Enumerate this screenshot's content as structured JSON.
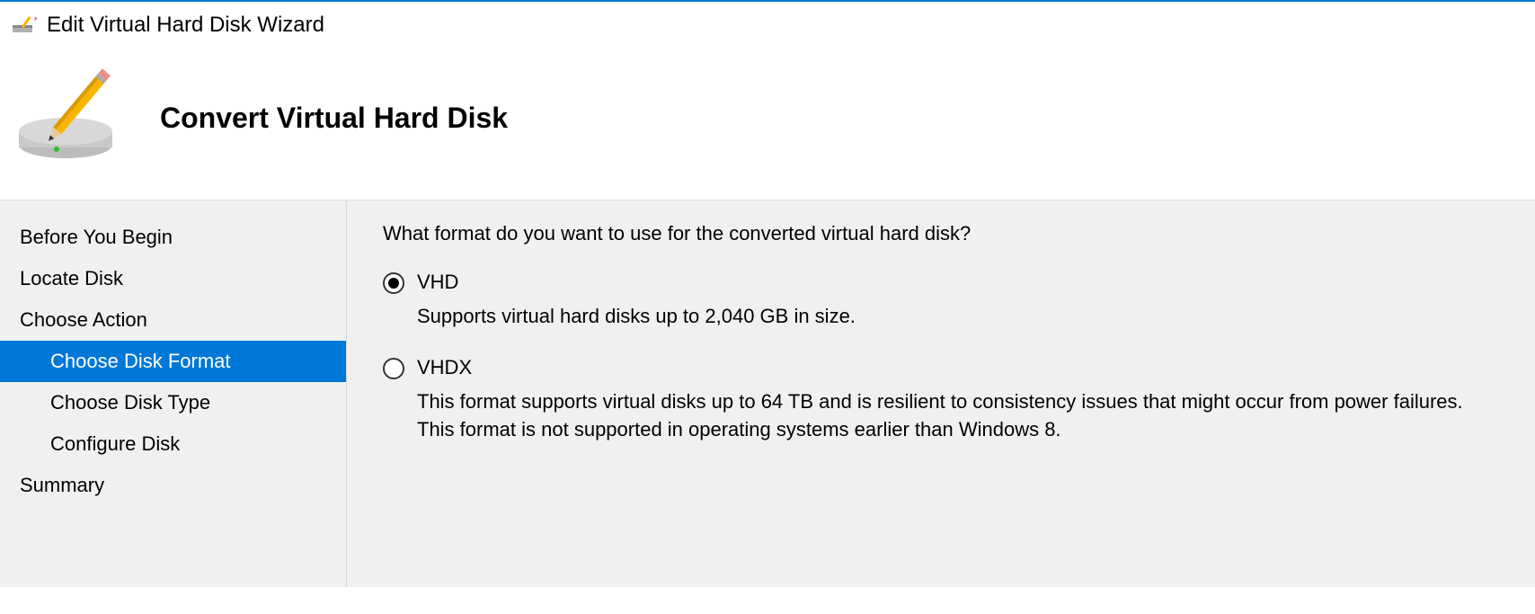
{
  "window": {
    "title": "Edit Virtual Hard Disk Wizard"
  },
  "header": {
    "title": "Convert Virtual Hard Disk"
  },
  "sidebar": {
    "items": [
      {
        "label": "Before You Begin",
        "sub": false,
        "selected": false
      },
      {
        "label": "Locate Disk",
        "sub": false,
        "selected": false
      },
      {
        "label": "Choose Action",
        "sub": false,
        "selected": false
      },
      {
        "label": "Choose Disk Format",
        "sub": true,
        "selected": true
      },
      {
        "label": "Choose Disk Type",
        "sub": true,
        "selected": false
      },
      {
        "label": "Configure Disk",
        "sub": true,
        "selected": false
      },
      {
        "label": "Summary",
        "sub": false,
        "selected": false
      }
    ]
  },
  "content": {
    "prompt": "What format do you want to use for the converted virtual hard disk?",
    "options": [
      {
        "label": "VHD",
        "checked": true,
        "description": "Supports virtual hard disks up to 2,040 GB in size."
      },
      {
        "label": "VHDX",
        "checked": false,
        "description": "This format supports virtual disks up to 64 TB and is resilient to consistency issues that might occur from power failures. This format is not supported in operating systems earlier than Windows 8."
      }
    ]
  }
}
